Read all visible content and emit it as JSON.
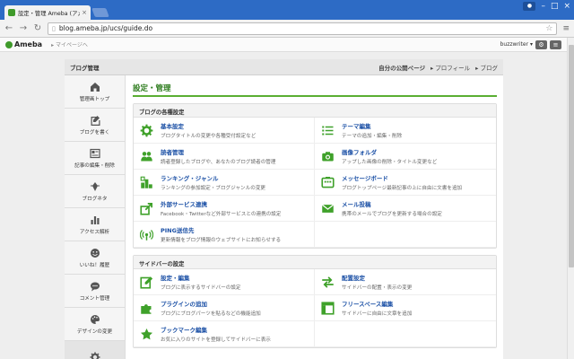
{
  "browser": {
    "tab_title": "設定・管理 Ameba (アメ…",
    "tab_close": "×",
    "window_controls": [
      "–",
      "□",
      "×"
    ],
    "url": "blog.ameba.jp/ucs/guide.do"
  },
  "ameba": {
    "logo": "Ameba",
    "mypage": "▸ マイページへ",
    "username": "buzzwriter ▾"
  },
  "header": {
    "title": "ブログ管理",
    "links": [
      "自分の公開ページ",
      "▸ プロフィール",
      "▸ ブログ"
    ]
  },
  "sidebar": {
    "items": [
      {
        "label": "管理画トップ",
        "icon": "home-icon"
      },
      {
        "label": "ブログを書く",
        "icon": "edit-icon"
      },
      {
        "label": "記事の編集・削除",
        "icon": "articles-icon"
      },
      {
        "label": "ブログネタ",
        "icon": "theme-icon"
      },
      {
        "label": "アクセス解析",
        "icon": "bar-chart-icon"
      },
      {
        "label": "いいね！履歴",
        "icon": "smile-icon"
      },
      {
        "label": "コメント管理",
        "icon": "comment-icon"
      },
      {
        "label": "デザインの変更",
        "icon": "palette-icon"
      },
      {
        "label": "",
        "icon": "gear-icon"
      }
    ]
  },
  "main": {
    "title": "設定・管理",
    "sections": [
      {
        "title": "ブログの各種設定",
        "items": [
          {
            "name": "基本設定",
            "desc": "ブログタイトルの変更や各種受付設定など",
            "icon": "gear-icon"
          },
          {
            "name": "テーマ編集",
            "desc": "テーマの追加・編集・削除",
            "icon": "list-icon"
          },
          {
            "name": "読者管理",
            "desc": "読者登録したブログや、あなたのブログ読者の管理",
            "icon": "users-icon"
          },
          {
            "name": "画像フォルダ",
            "desc": "アップした画像の削除・タイトル変更など",
            "icon": "camera-icon"
          },
          {
            "name": "ランキング・ジャンル",
            "desc": "ランキングの参加設定・ブログジャンルの変更",
            "icon": "ranking-icon"
          },
          {
            "name": "メッセージボード",
            "desc": "ブログトップページ最新記事の上に自由に文書を追加",
            "icon": "board-icon"
          },
          {
            "name": "外部サービス連携",
            "desc": "Facebook・Twitterなど外部サービスとの連携の設定",
            "icon": "share-icon"
          },
          {
            "name": "メール投稿",
            "desc": "携帯のメールでブログを更新する場合の設定",
            "icon": "mail-icon"
          },
          {
            "name": "PING送信先",
            "desc": "更新情報をブログ情報のウェブサイトにお知らせする",
            "icon": "ping-icon"
          },
          {
            "name": "",
            "desc": "",
            "icon": ""
          }
        ]
      },
      {
        "title": "サイドバーの設定",
        "items": [
          {
            "name": "設定・編集",
            "desc": "ブログに表示するサイドバーの設定",
            "icon": "edit-box-icon"
          },
          {
            "name": "配置設定",
            "desc": "サイドバーの配置・表示の変更",
            "icon": "swap-icon"
          },
          {
            "name": "プラグインの追加",
            "desc": "ブログにブログパーツを貼るなどの機能追加",
            "icon": "puzzle-icon"
          },
          {
            "name": "フリースペース編集",
            "desc": "サイドバーに自由に文章を追加",
            "icon": "layout-icon"
          },
          {
            "name": "ブックマーク編集",
            "desc": "お気に入りのサイトを登録してサイドバーに表示",
            "icon": "star-icon"
          },
          {
            "name": "",
            "desc": "",
            "icon": ""
          }
        ]
      }
    ]
  },
  "colors": {
    "accent": "#5aae32",
    "link": "#1a4fa5",
    "titlebar": "#2d6bc5"
  }
}
